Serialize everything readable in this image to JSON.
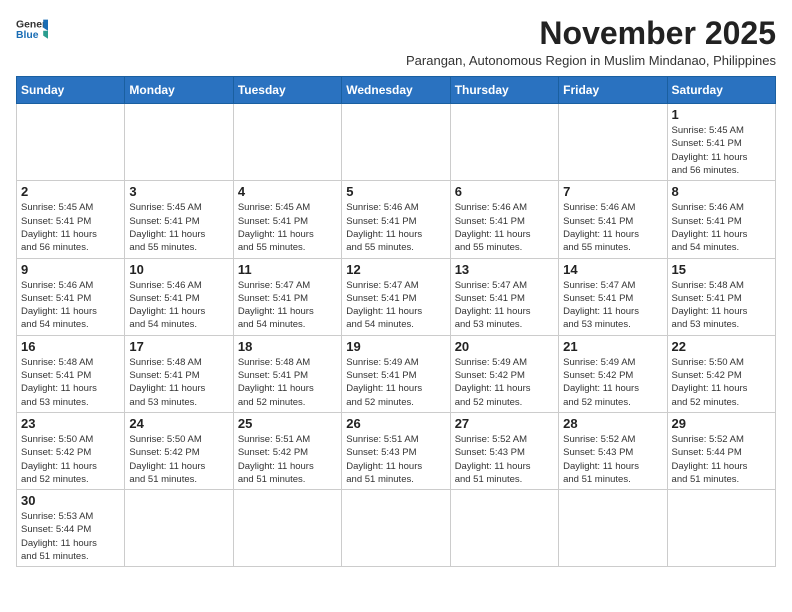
{
  "logo": {
    "line1": "General",
    "line2": "Blue"
  },
  "title": "November 2025",
  "subtitle": "Parangan, Autonomous Region in Muslim Mindanao, Philippines",
  "headers": [
    "Sunday",
    "Monday",
    "Tuesday",
    "Wednesday",
    "Thursday",
    "Friday",
    "Saturday"
  ],
  "weeks": [
    [
      {
        "day": "",
        "info": ""
      },
      {
        "day": "",
        "info": ""
      },
      {
        "day": "",
        "info": ""
      },
      {
        "day": "",
        "info": ""
      },
      {
        "day": "",
        "info": ""
      },
      {
        "day": "",
        "info": ""
      },
      {
        "day": "1",
        "info": "Sunrise: 5:45 AM\nSunset: 5:41 PM\nDaylight: 11 hours\nand 56 minutes."
      }
    ],
    [
      {
        "day": "2",
        "info": "Sunrise: 5:45 AM\nSunset: 5:41 PM\nDaylight: 11 hours\nand 56 minutes."
      },
      {
        "day": "3",
        "info": "Sunrise: 5:45 AM\nSunset: 5:41 PM\nDaylight: 11 hours\nand 55 minutes."
      },
      {
        "day": "4",
        "info": "Sunrise: 5:45 AM\nSunset: 5:41 PM\nDaylight: 11 hours\nand 55 minutes."
      },
      {
        "day": "5",
        "info": "Sunrise: 5:46 AM\nSunset: 5:41 PM\nDaylight: 11 hours\nand 55 minutes."
      },
      {
        "day": "6",
        "info": "Sunrise: 5:46 AM\nSunset: 5:41 PM\nDaylight: 11 hours\nand 55 minutes."
      },
      {
        "day": "7",
        "info": "Sunrise: 5:46 AM\nSunset: 5:41 PM\nDaylight: 11 hours\nand 55 minutes."
      },
      {
        "day": "8",
        "info": "Sunrise: 5:46 AM\nSunset: 5:41 PM\nDaylight: 11 hours\nand 54 minutes."
      }
    ],
    [
      {
        "day": "9",
        "info": "Sunrise: 5:46 AM\nSunset: 5:41 PM\nDaylight: 11 hours\nand 54 minutes."
      },
      {
        "day": "10",
        "info": "Sunrise: 5:46 AM\nSunset: 5:41 PM\nDaylight: 11 hours\nand 54 minutes."
      },
      {
        "day": "11",
        "info": "Sunrise: 5:47 AM\nSunset: 5:41 PM\nDaylight: 11 hours\nand 54 minutes."
      },
      {
        "day": "12",
        "info": "Sunrise: 5:47 AM\nSunset: 5:41 PM\nDaylight: 11 hours\nand 54 minutes."
      },
      {
        "day": "13",
        "info": "Sunrise: 5:47 AM\nSunset: 5:41 PM\nDaylight: 11 hours\nand 53 minutes."
      },
      {
        "day": "14",
        "info": "Sunrise: 5:47 AM\nSunset: 5:41 PM\nDaylight: 11 hours\nand 53 minutes."
      },
      {
        "day": "15",
        "info": "Sunrise: 5:48 AM\nSunset: 5:41 PM\nDaylight: 11 hours\nand 53 minutes."
      }
    ],
    [
      {
        "day": "16",
        "info": "Sunrise: 5:48 AM\nSunset: 5:41 PM\nDaylight: 11 hours\nand 53 minutes."
      },
      {
        "day": "17",
        "info": "Sunrise: 5:48 AM\nSunset: 5:41 PM\nDaylight: 11 hours\nand 53 minutes."
      },
      {
        "day": "18",
        "info": "Sunrise: 5:48 AM\nSunset: 5:41 PM\nDaylight: 11 hours\nand 52 minutes."
      },
      {
        "day": "19",
        "info": "Sunrise: 5:49 AM\nSunset: 5:41 PM\nDaylight: 11 hours\nand 52 minutes."
      },
      {
        "day": "20",
        "info": "Sunrise: 5:49 AM\nSunset: 5:42 PM\nDaylight: 11 hours\nand 52 minutes."
      },
      {
        "day": "21",
        "info": "Sunrise: 5:49 AM\nSunset: 5:42 PM\nDaylight: 11 hours\nand 52 minutes."
      },
      {
        "day": "22",
        "info": "Sunrise: 5:50 AM\nSunset: 5:42 PM\nDaylight: 11 hours\nand 52 minutes."
      }
    ],
    [
      {
        "day": "23",
        "info": "Sunrise: 5:50 AM\nSunset: 5:42 PM\nDaylight: 11 hours\nand 52 minutes."
      },
      {
        "day": "24",
        "info": "Sunrise: 5:50 AM\nSunset: 5:42 PM\nDaylight: 11 hours\nand 51 minutes."
      },
      {
        "day": "25",
        "info": "Sunrise: 5:51 AM\nSunset: 5:42 PM\nDaylight: 11 hours\nand 51 minutes."
      },
      {
        "day": "26",
        "info": "Sunrise: 5:51 AM\nSunset: 5:43 PM\nDaylight: 11 hours\nand 51 minutes."
      },
      {
        "day": "27",
        "info": "Sunrise: 5:52 AM\nSunset: 5:43 PM\nDaylight: 11 hours\nand 51 minutes."
      },
      {
        "day": "28",
        "info": "Sunrise: 5:52 AM\nSunset: 5:43 PM\nDaylight: 11 hours\nand 51 minutes."
      },
      {
        "day": "29",
        "info": "Sunrise: 5:52 AM\nSunset: 5:44 PM\nDaylight: 11 hours\nand 51 minutes."
      }
    ],
    [
      {
        "day": "30",
        "info": "Sunrise: 5:53 AM\nSunset: 5:44 PM\nDaylight: 11 hours\nand 51 minutes."
      },
      {
        "day": "",
        "info": ""
      },
      {
        "day": "",
        "info": ""
      },
      {
        "day": "",
        "info": ""
      },
      {
        "day": "",
        "info": ""
      },
      {
        "day": "",
        "info": ""
      },
      {
        "day": "",
        "info": ""
      }
    ]
  ]
}
